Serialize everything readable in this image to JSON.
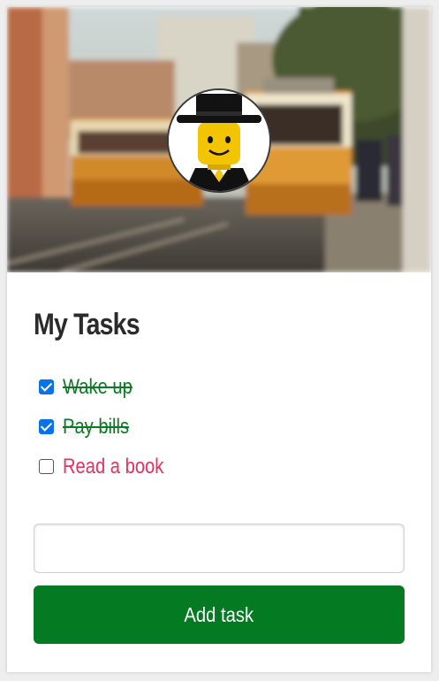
{
  "app": {
    "title": "My Tasks"
  },
  "tasks": [
    {
      "label": "Wake up",
      "done": true
    },
    {
      "label": "Pay bills",
      "done": true
    },
    {
      "label": "Read a book",
      "done": false
    }
  ],
  "new_task": {
    "value": "",
    "placeholder": ""
  },
  "add_button": {
    "label": "Add task"
  },
  "colors": {
    "done_text": "#0b7a24",
    "todo_text": "#e8305e",
    "button_bg": "#047a22",
    "checkbox_checked": "#0a72e8"
  },
  "icons": {
    "avatar": "lego-minifigure-avatar",
    "hero": "tram-street-photo"
  }
}
